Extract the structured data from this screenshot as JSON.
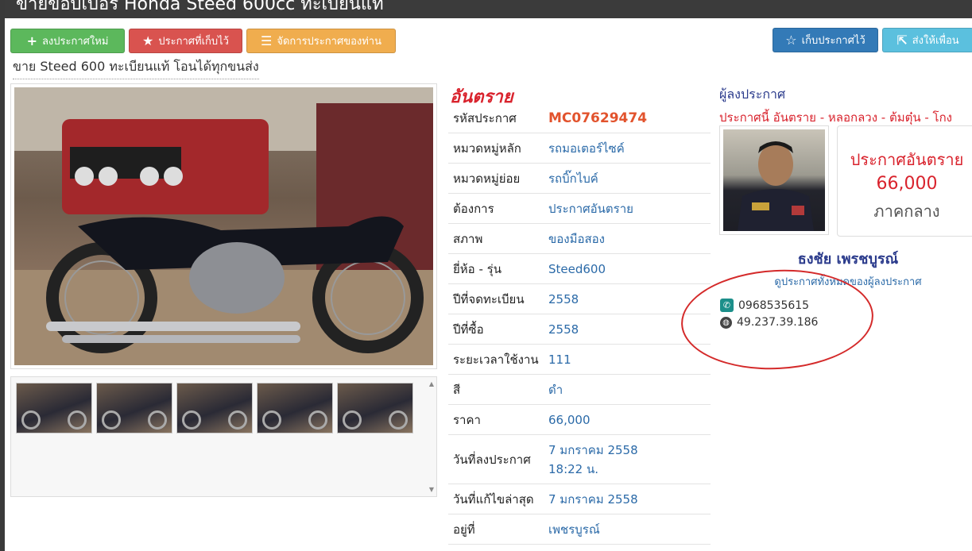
{
  "header": {
    "title": "ขายขอบเบอร Honda Steed 600cc ทะเบียนแท้"
  },
  "toolbar": {
    "post_new": "ลงประกาศใหม่",
    "saved": "ประกาศที่เก็บไว้",
    "manage": "จัดการประกาศของท่าน",
    "save_listing": "เก็บประกาศไว้",
    "send_friend": "ส่งให้เพื่อน"
  },
  "listing": {
    "title": "ขาย Steed 600 ทะเบียนแท้ โอนได้ทุกขนส่ง"
  },
  "specs": {
    "heading": "อันตราย",
    "rows": [
      {
        "label": "รหัสประกาศ",
        "value": "MC07629474"
      },
      {
        "label": "หมวดหมู่หลัก",
        "value": "รถมอเตอร์ไซค์"
      },
      {
        "label": "หมวดหมู่ย่อย",
        "value": "รถบิ๊กไบค์"
      },
      {
        "label": "ต้องการ",
        "value": "ประกาศอันตราย"
      },
      {
        "label": "สภาพ",
        "value": "ของมือสอง"
      },
      {
        "label": "ยี่ห้อ - รุ่น",
        "value": "Steed600"
      },
      {
        "label": "ปีที่จดทะเบียน",
        "value": "2558"
      },
      {
        "label": "ปีที่ซื้อ",
        "value": "2558"
      },
      {
        "label": "ระยะเวลาใช้งาน",
        "value": "111"
      },
      {
        "label": "สี",
        "value": "ดำ"
      },
      {
        "label": "ราคา",
        "value": "66,000"
      },
      {
        "label": "วันที่ลงประกาศ",
        "value": "7 มกราคม 2558",
        "value2": "18:22 น."
      },
      {
        "label": "วันที่แก้ไขล่าสุด",
        "value": "7 มกราคม 2558"
      },
      {
        "label": "อยู่ที่",
        "value": "เพชรบูรณ์"
      }
    ]
  },
  "poster": {
    "heading": "ผู้ลงประกาศ",
    "warning": "ประกาศนี้ อันตราย - หลอกลวง - ต้มตุ๋น - โกง",
    "price_status": "ประกาศอันตราย",
    "price": "66,000",
    "region": "ภาคกลาง",
    "name": "ธงชัย เพรชบูรณ์",
    "all_listings": "ดูประกาศทั้งหมดของผู้ลงประกาศ",
    "phone": "0968535615",
    "ip": "49.237.39.186"
  },
  "colors": {
    "accent_red": "#d9232d",
    "link_blue": "#2b6aa8",
    "ring": "#d42a2a"
  },
  "icons": [
    "plus-icon",
    "star-icon",
    "list-icon",
    "share-icon",
    "phone-icon",
    "globe-icon"
  ]
}
